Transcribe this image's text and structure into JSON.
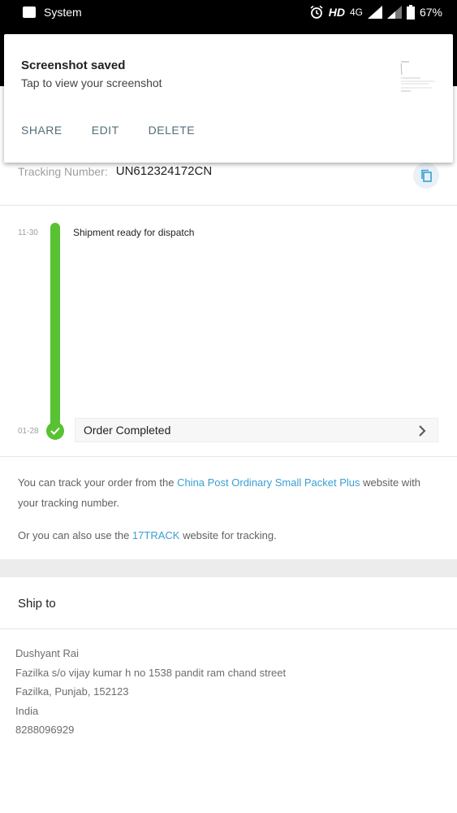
{
  "status_bar": {
    "app_name": "System",
    "network_hd": "HD",
    "network_4g": "4G",
    "battery": "67%"
  },
  "notification": {
    "title": "Screenshot saved",
    "subtitle": "Tap to view your screenshot",
    "actions": [
      "SHARE",
      "EDIT",
      "DELETE"
    ]
  },
  "tracking": {
    "label": "Tracking Number:",
    "number": "UN612324172CN"
  },
  "timeline": [
    {
      "date": "11-30",
      "text": "Shipment ready for dispatch"
    },
    {
      "date": "01-28",
      "text": "Order Completed"
    }
  ],
  "info": {
    "p1_pre": "You can track your order from the ",
    "p1_link": "China Post Ordinary Small Packet Plus",
    "p1_post": " website with your tracking number.",
    "p2_pre": "Or you can also use the ",
    "p2_link": "17TRACK",
    "p2_post": " website for tracking."
  },
  "ship_to": {
    "title": "Ship to",
    "name": "Dushyant Rai",
    "street": "Fazilka s/o vijay kumar h no 1538 pandit ram chand street",
    "city": "Fazilka, Punjab, 152123",
    "country": "India",
    "phone": "8288096929"
  },
  "colors": {
    "accent_green": "#58c232",
    "link_blue": "#3a9fd3"
  }
}
